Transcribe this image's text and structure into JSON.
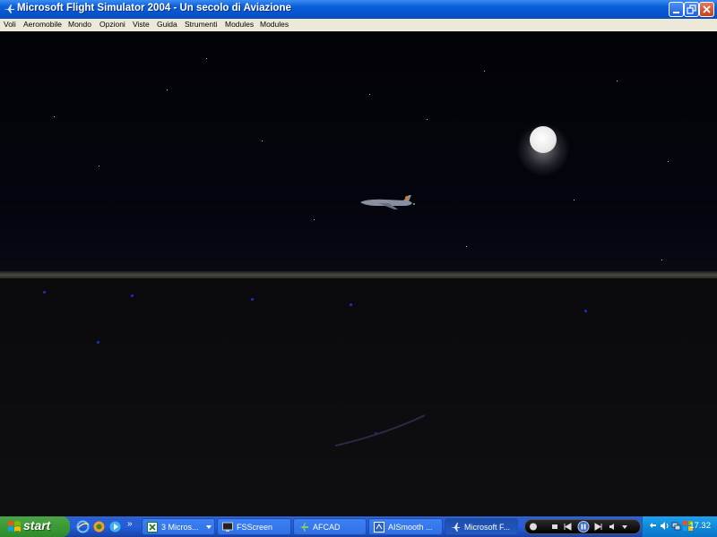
{
  "window": {
    "title": "Microsoft Flight Simulator 2004 - Un secolo di Aviazione",
    "icon": "airplane-app-icon",
    "controls": [
      "minimize-icon",
      "restore-icon",
      "close-icon"
    ]
  },
  "menu": {
    "items": [
      "Voli",
      "Aeromobile",
      "Mondo",
      "Opzioni",
      "Viste",
      "Guida",
      "Strumenti",
      "Modules",
      "Modules"
    ]
  },
  "scene": {
    "sky_color": "#04040a",
    "moon_color": "#f0f0f0",
    "ground_point_color": "#2030c0"
  },
  "taskbar": {
    "start_label": "start",
    "quick_launch": [
      "ie-icon",
      "messenger-icon",
      "windows-media-icon"
    ],
    "more_label": "»",
    "tasks": [
      {
        "label": "3 Micros...",
        "icon": "excel-icon",
        "has_dropdown": true
      },
      {
        "label": "FSScreen",
        "icon": "fsscreen-icon"
      },
      {
        "label": "AFCAD",
        "icon": "afcad-icon"
      },
      {
        "label": "AISmooth ...",
        "icon": "aismooth-icon"
      },
      {
        "label": "Microsoft F...",
        "icon": "flight-sim-icon",
        "active": true
      }
    ],
    "clock": "17.32"
  }
}
